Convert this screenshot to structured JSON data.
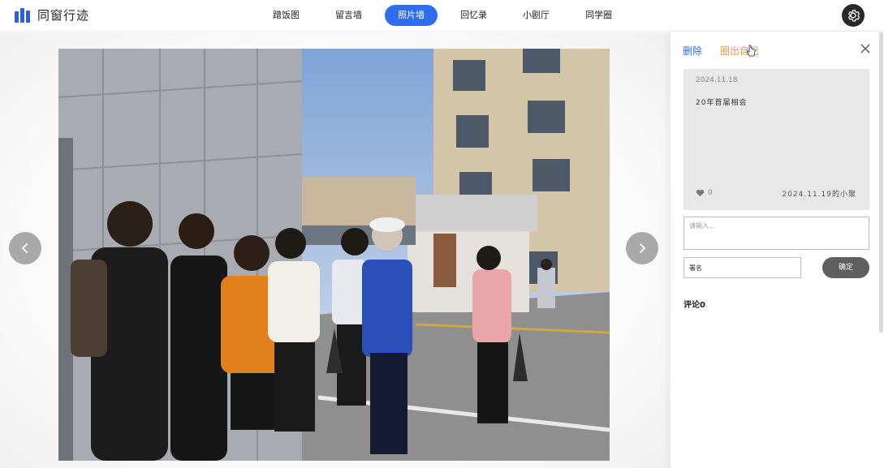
{
  "header": {
    "app_title": "同窗行迹",
    "nav": [
      {
        "label": "蹭饭图",
        "active": false
      },
      {
        "label": "留言墙",
        "active": false
      },
      {
        "label": "照片墙",
        "active": true
      },
      {
        "label": "回忆录",
        "active": false
      },
      {
        "label": "小剧厅",
        "active": false
      },
      {
        "label": "同学圈",
        "active": false
      }
    ],
    "settings_icon": "gear-icon"
  },
  "viewer": {
    "prev_icon": "chevron-left-icon",
    "next_icon": "chevron-right-icon"
  },
  "panel": {
    "delete_label": "删除",
    "generate_label": "圈出自己",
    "close_icon": "close-icon",
    "card": {
      "date": "2024.11.18",
      "text": "20年首届相会",
      "likes": "0",
      "author": "2024.11.19的小聚"
    },
    "comment_placeholder": "请输入...",
    "name_placeholder": "署名",
    "confirm_label": "确定",
    "comment_count_label": "评论0"
  },
  "colors": {
    "accent": "#2f6cf0",
    "highlight": "#e29b3c",
    "button_dark": "#5f5f5f"
  }
}
